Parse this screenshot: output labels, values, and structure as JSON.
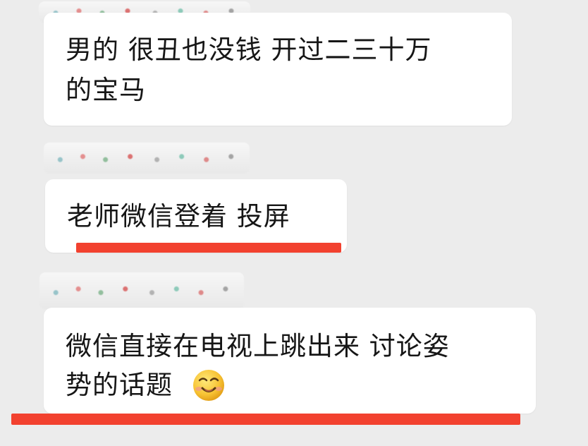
{
  "messages": [
    {
      "line1": "男的 很丑也没钱 开过二三十万",
      "line2": "的宝马"
    },
    {
      "text": "老师微信登着 投屏"
    },
    {
      "line1": "微信直接在电视上跳出来 讨论姿",
      "line2": "势的话题",
      "emoji": "smirk-emoji"
    }
  ],
  "colors": {
    "background": "#ececec",
    "bubble": "#ffffff",
    "text": "#161616",
    "underline": "#f2412f"
  }
}
